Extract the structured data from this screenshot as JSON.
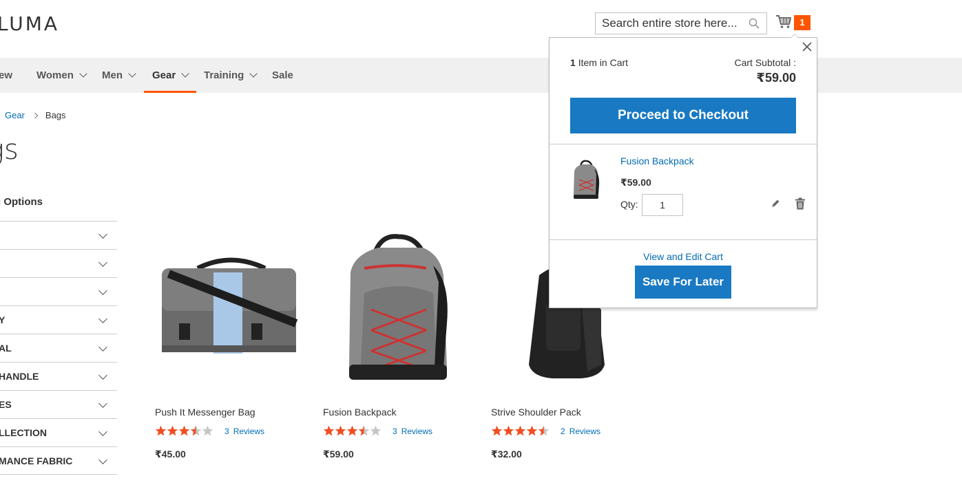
{
  "header": {
    "logo_text": "LUMA",
    "search_placeholder": "Search entire store here...",
    "cart_count": "1"
  },
  "nav": {
    "items": [
      {
        "label": "ew"
      },
      {
        "label": "Women"
      },
      {
        "label": "Men"
      },
      {
        "label": "Gear"
      },
      {
        "label": "Training"
      },
      {
        "label": "Sale"
      }
    ],
    "active": "Gear"
  },
  "breadcrumb": {
    "items": [
      "Gear",
      "Bags"
    ]
  },
  "page": {
    "title": "gs"
  },
  "sidebar": {
    "title": "g Options",
    "filters": [
      "",
      "",
      "",
      "Y",
      "AL",
      "HANDLE",
      "ES",
      "LLECTION",
      "MANCE FABRIC"
    ]
  },
  "products": [
    {
      "name": "Push It Messenger Bag",
      "rating_stars": 3.5,
      "review_count": "3",
      "review_label": "Reviews",
      "price": "₹45.00"
    },
    {
      "name": "Fusion Backpack",
      "rating_stars": 3.5,
      "review_count": "3",
      "review_label": "Reviews",
      "price": "₹59.00"
    },
    {
      "name": "Strive Shoulder Pack",
      "rating_stars": 4.5,
      "review_count": "2",
      "review_label": "Reviews",
      "price": "₹32.00"
    }
  ],
  "minicart": {
    "items_count": "1",
    "items_label": "Item in Cart",
    "subtotal_label": "Cart Subtotal :",
    "subtotal_value": "₹59.00",
    "checkout_label": "Proceed to Checkout",
    "item": {
      "name": "Fusion Backpack",
      "price": "₹59.00",
      "qty_label": "Qty:",
      "qty_value": "1"
    },
    "view_cart_label": "View and Edit Cart",
    "save_later_label": "Save For Later"
  },
  "colors": {
    "accent": "#ff5501",
    "primary": "#1979c3",
    "link": "#006bb4",
    "star": "#f04e23"
  }
}
